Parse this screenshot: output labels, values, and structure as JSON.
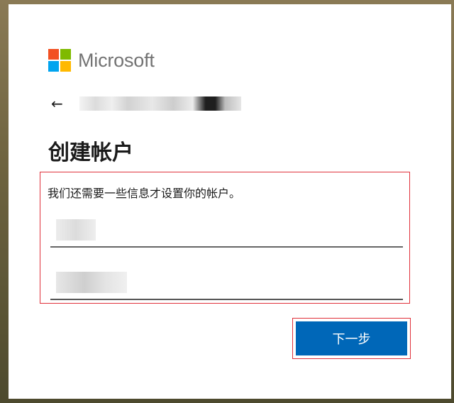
{
  "brand": {
    "name": "Microsoft",
    "colors": [
      "#f25022",
      "#7fba00",
      "#00a4ef",
      "#ffb900"
    ]
  },
  "nav": {
    "back_icon": "←"
  },
  "page": {
    "title": "创建帐户",
    "subtitle": "我们还需要一些信息才设置你的帐户。"
  },
  "buttons": {
    "next_label": "下一步"
  },
  "colors": {
    "accent": "#0067b8",
    "highlight_border": "#e0303a"
  }
}
